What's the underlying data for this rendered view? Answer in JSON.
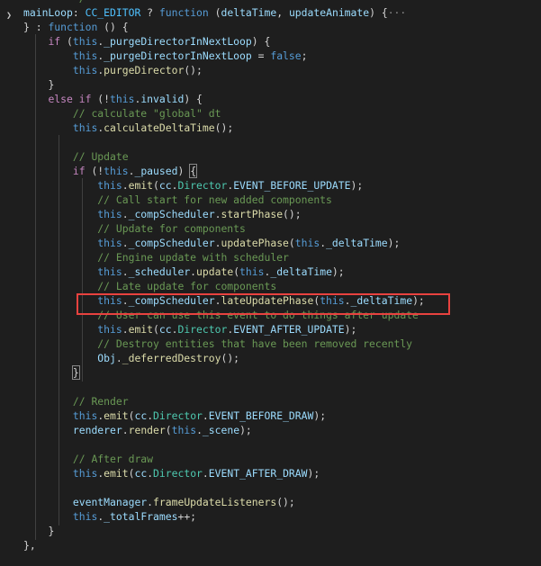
{
  "editor": {
    "lines": [
      {
        "indent": 2,
        "tokens": [
          {
            "t": "*/",
            "c": "com"
          }
        ]
      },
      {
        "indent": 0,
        "tokens": [
          {
            "t": "mainLoop",
            "c": "prop"
          },
          {
            "t": ": ",
            "c": "pun"
          },
          {
            "t": "CC_EDITOR",
            "c": "const"
          },
          {
            "t": " ? ",
            "c": "pun"
          },
          {
            "t": "function",
            "c": "kw"
          },
          {
            "t": " (",
            "c": "pun"
          },
          {
            "t": "deltaTime",
            "c": "prop"
          },
          {
            "t": ", ",
            "c": "pun"
          },
          {
            "t": "updateAnimate",
            "c": "prop"
          },
          {
            "t": ") {",
            "c": "pun"
          },
          {
            "t": "···",
            "c": "ellipsis"
          }
        ]
      },
      {
        "indent": 0,
        "tokens": [
          {
            "t": "} : ",
            "c": "pun"
          },
          {
            "t": "function",
            "c": "kw"
          },
          {
            "t": " () {",
            "c": "pun"
          }
        ]
      },
      {
        "indent": 1,
        "tokens": [
          {
            "t": "if",
            "c": "ctl"
          },
          {
            "t": " (",
            "c": "pun"
          },
          {
            "t": "this",
            "c": "kw"
          },
          {
            "t": ".",
            "c": "pun"
          },
          {
            "t": "_purgeDirectorInNextLoop",
            "c": "prop"
          },
          {
            "t": ") {",
            "c": "pun"
          }
        ]
      },
      {
        "indent": 2,
        "tokens": [
          {
            "t": "this",
            "c": "kw"
          },
          {
            "t": ".",
            "c": "pun"
          },
          {
            "t": "_purgeDirectorInNextLoop",
            "c": "prop"
          },
          {
            "t": " = ",
            "c": "pun"
          },
          {
            "t": "false",
            "c": "kw"
          },
          {
            "t": ";",
            "c": "pun"
          }
        ]
      },
      {
        "indent": 2,
        "tokens": [
          {
            "t": "this",
            "c": "kw"
          },
          {
            "t": ".",
            "c": "pun"
          },
          {
            "t": "purgeDirector",
            "c": "fn"
          },
          {
            "t": "();",
            "c": "pun"
          }
        ]
      },
      {
        "indent": 1,
        "tokens": [
          {
            "t": "}",
            "c": "pun"
          }
        ]
      },
      {
        "indent": 1,
        "tokens": [
          {
            "t": "else",
            "c": "ctl"
          },
          {
            "t": " ",
            "c": "pun"
          },
          {
            "t": "if",
            "c": "ctl"
          },
          {
            "t": " (!",
            "c": "pun"
          },
          {
            "t": "this",
            "c": "kw"
          },
          {
            "t": ".",
            "c": "pun"
          },
          {
            "t": "invalid",
            "c": "prop"
          },
          {
            "t": ") {",
            "c": "pun"
          }
        ]
      },
      {
        "indent": 2,
        "tokens": [
          {
            "t": "// calculate \"global\" dt",
            "c": "com"
          }
        ]
      },
      {
        "indent": 2,
        "tokens": [
          {
            "t": "this",
            "c": "kw"
          },
          {
            "t": ".",
            "c": "pun"
          },
          {
            "t": "calculateDeltaTime",
            "c": "fn"
          },
          {
            "t": "();",
            "c": "pun"
          }
        ]
      },
      {
        "indent": 0,
        "tokens": []
      },
      {
        "indent": 2,
        "tokens": [
          {
            "t": "// Update",
            "c": "com"
          }
        ]
      },
      {
        "indent": 2,
        "tokens": [
          {
            "t": "if",
            "c": "ctl"
          },
          {
            "t": " (!",
            "c": "pun"
          },
          {
            "t": "this",
            "c": "kw"
          },
          {
            "t": ".",
            "c": "pun"
          },
          {
            "t": "_paused",
            "c": "prop"
          },
          {
            "t": ") ",
            "c": "pun"
          },
          {
            "t": "{",
            "c": "pun",
            "box": true
          }
        ]
      },
      {
        "indent": 3,
        "tokens": [
          {
            "t": "this",
            "c": "kw"
          },
          {
            "t": ".",
            "c": "pun"
          },
          {
            "t": "emit",
            "c": "fn"
          },
          {
            "t": "(",
            "c": "pun"
          },
          {
            "t": "cc",
            "c": "prop"
          },
          {
            "t": ".",
            "c": "pun"
          },
          {
            "t": "Director",
            "c": "cls"
          },
          {
            "t": ".",
            "c": "pun"
          },
          {
            "t": "EVENT_BEFORE_UPDATE",
            "c": "prop"
          },
          {
            "t": ");",
            "c": "pun"
          }
        ]
      },
      {
        "indent": 3,
        "tokens": [
          {
            "t": "// Call start for new added components",
            "c": "com"
          }
        ]
      },
      {
        "indent": 3,
        "tokens": [
          {
            "t": "this",
            "c": "kw"
          },
          {
            "t": ".",
            "c": "pun"
          },
          {
            "t": "_compScheduler",
            "c": "prop"
          },
          {
            "t": ".",
            "c": "pun"
          },
          {
            "t": "startPhase",
            "c": "fn"
          },
          {
            "t": "();",
            "c": "pun"
          }
        ]
      },
      {
        "indent": 3,
        "tokens": [
          {
            "t": "// Update for components",
            "c": "com"
          }
        ]
      },
      {
        "indent": 3,
        "tokens": [
          {
            "t": "this",
            "c": "kw"
          },
          {
            "t": ".",
            "c": "pun"
          },
          {
            "t": "_compScheduler",
            "c": "prop"
          },
          {
            "t": ".",
            "c": "pun"
          },
          {
            "t": "updatePhase",
            "c": "fn"
          },
          {
            "t": "(",
            "c": "pun"
          },
          {
            "t": "this",
            "c": "kw"
          },
          {
            "t": ".",
            "c": "pun"
          },
          {
            "t": "_deltaTime",
            "c": "prop"
          },
          {
            "t": ");",
            "c": "pun"
          }
        ]
      },
      {
        "indent": 3,
        "tokens": [
          {
            "t": "// Engine update with scheduler",
            "c": "com"
          }
        ]
      },
      {
        "indent": 3,
        "tokens": [
          {
            "t": "this",
            "c": "kw"
          },
          {
            "t": ".",
            "c": "pun"
          },
          {
            "t": "_scheduler",
            "c": "prop"
          },
          {
            "t": ".",
            "c": "pun"
          },
          {
            "t": "update",
            "c": "fn"
          },
          {
            "t": "(",
            "c": "pun"
          },
          {
            "t": "this",
            "c": "kw"
          },
          {
            "t": ".",
            "c": "pun"
          },
          {
            "t": "_deltaTime",
            "c": "prop"
          },
          {
            "t": ");",
            "c": "pun"
          }
        ]
      },
      {
        "indent": 3,
        "tokens": [
          {
            "t": "// Late update for components",
            "c": "com"
          }
        ]
      },
      {
        "indent": 3,
        "tokens": [
          {
            "t": "this",
            "c": "kw"
          },
          {
            "t": ".",
            "c": "pun"
          },
          {
            "t": "_compScheduler",
            "c": "prop"
          },
          {
            "t": ".",
            "c": "pun"
          },
          {
            "t": "lateUpdatePhase",
            "c": "fn"
          },
          {
            "t": "(",
            "c": "pun"
          },
          {
            "t": "this",
            "c": "kw"
          },
          {
            "t": ".",
            "c": "pun"
          },
          {
            "t": "_deltaTime",
            "c": "prop"
          },
          {
            "t": ");",
            "c": "pun"
          }
        ]
      },
      {
        "indent": 3,
        "tokens": [
          {
            "t": "// User can use this event to do things after update",
            "c": "com"
          }
        ]
      },
      {
        "indent": 3,
        "tokens": [
          {
            "t": "this",
            "c": "kw"
          },
          {
            "t": ".",
            "c": "pun"
          },
          {
            "t": "emit",
            "c": "fn"
          },
          {
            "t": "(",
            "c": "pun"
          },
          {
            "t": "cc",
            "c": "prop"
          },
          {
            "t": ".",
            "c": "pun"
          },
          {
            "t": "Director",
            "c": "cls"
          },
          {
            "t": ".",
            "c": "pun"
          },
          {
            "t": "EVENT_AFTER_UPDATE",
            "c": "prop"
          },
          {
            "t": ");",
            "c": "pun"
          }
        ]
      },
      {
        "indent": 3,
        "tokens": [
          {
            "t": "// Destroy entities that have been removed recently",
            "c": "com"
          }
        ]
      },
      {
        "indent": 3,
        "tokens": [
          {
            "t": "Obj",
            "c": "prop"
          },
          {
            "t": ".",
            "c": "pun"
          },
          {
            "t": "_deferredDestroy",
            "c": "fn"
          },
          {
            "t": "();",
            "c": "pun"
          }
        ]
      },
      {
        "indent": 2,
        "tokens": [
          {
            "t": "}",
            "c": "pun",
            "box": true
          }
        ]
      },
      {
        "indent": 0,
        "tokens": []
      },
      {
        "indent": 2,
        "tokens": [
          {
            "t": "// Render",
            "c": "com"
          }
        ]
      },
      {
        "indent": 2,
        "tokens": [
          {
            "t": "this",
            "c": "kw"
          },
          {
            "t": ".",
            "c": "pun"
          },
          {
            "t": "emit",
            "c": "fn"
          },
          {
            "t": "(",
            "c": "pun"
          },
          {
            "t": "cc",
            "c": "prop"
          },
          {
            "t": ".",
            "c": "pun"
          },
          {
            "t": "Director",
            "c": "cls"
          },
          {
            "t": ".",
            "c": "pun"
          },
          {
            "t": "EVENT_BEFORE_DRAW",
            "c": "prop"
          },
          {
            "t": ");",
            "c": "pun"
          }
        ]
      },
      {
        "indent": 2,
        "tokens": [
          {
            "t": "renderer",
            "c": "prop"
          },
          {
            "t": ".",
            "c": "pun"
          },
          {
            "t": "render",
            "c": "fn"
          },
          {
            "t": "(",
            "c": "pun"
          },
          {
            "t": "this",
            "c": "kw"
          },
          {
            "t": ".",
            "c": "pun"
          },
          {
            "t": "_scene",
            "c": "prop"
          },
          {
            "t": ");",
            "c": "pun"
          }
        ]
      },
      {
        "indent": 0,
        "tokens": []
      },
      {
        "indent": 2,
        "tokens": [
          {
            "t": "// After draw",
            "c": "com"
          }
        ]
      },
      {
        "indent": 2,
        "tokens": [
          {
            "t": "this",
            "c": "kw"
          },
          {
            "t": ".",
            "c": "pun"
          },
          {
            "t": "emit",
            "c": "fn"
          },
          {
            "t": "(",
            "c": "pun"
          },
          {
            "t": "cc",
            "c": "prop"
          },
          {
            "t": ".",
            "c": "pun"
          },
          {
            "t": "Director",
            "c": "cls"
          },
          {
            "t": ".",
            "c": "pun"
          },
          {
            "t": "EVENT_AFTER_DRAW",
            "c": "prop"
          },
          {
            "t": ");",
            "c": "pun"
          }
        ]
      },
      {
        "indent": 0,
        "tokens": []
      },
      {
        "indent": 2,
        "tokens": [
          {
            "t": "eventManager",
            "c": "prop"
          },
          {
            "t": ".",
            "c": "pun"
          },
          {
            "t": "frameUpdateListeners",
            "c": "fn"
          },
          {
            "t": "();",
            "c": "pun"
          }
        ]
      },
      {
        "indent": 2,
        "tokens": [
          {
            "t": "this",
            "c": "kw"
          },
          {
            "t": ".",
            "c": "pun"
          },
          {
            "t": "_totalFrames",
            "c": "prop"
          },
          {
            "t": "++;",
            "c": "pun"
          }
        ]
      },
      {
        "indent": 1,
        "tokens": [
          {
            "t": "}",
            "c": "pun"
          }
        ]
      },
      {
        "indent": 0,
        "tokens": [
          {
            "t": "},",
            "c": "pun"
          }
        ]
      }
    ]
  },
  "colors": {
    "background": "#1e1e1e",
    "highlight_box": "#e8423f"
  },
  "icons": {
    "fold": "chevron-right-icon"
  }
}
